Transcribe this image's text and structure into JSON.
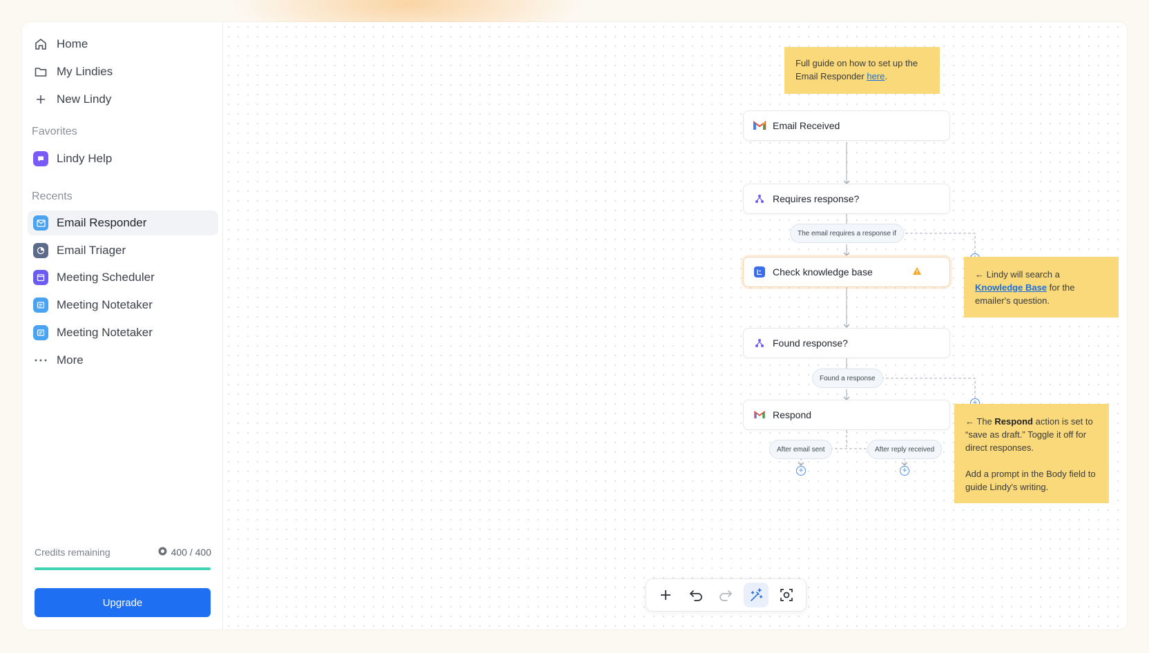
{
  "sidebar": {
    "nav": [
      {
        "label": "Home",
        "icon": "home-icon"
      },
      {
        "label": "My Lindies",
        "icon": "folder-icon"
      },
      {
        "label": "New Lindy",
        "icon": "plus-icon"
      }
    ],
    "favorites_label": "Favorites",
    "favorites": [
      {
        "label": "Lindy Help",
        "icon": "chat-bubble-icon",
        "color": "#7a5af8"
      }
    ],
    "recents_label": "Recents",
    "recents": [
      {
        "label": "Email Responder",
        "icon": "mail-icon",
        "color": "#4aa3f0",
        "active": true
      },
      {
        "label": "Email Triager",
        "icon": "pie-chart-icon",
        "color": "#5c6b8a"
      },
      {
        "label": "Meeting Scheduler",
        "icon": "calendar-icon",
        "color": "#6a5cf0"
      },
      {
        "label": "Meeting Notetaker",
        "icon": "notes-icon",
        "color": "#4aa3f0"
      },
      {
        "label": "Meeting Notetaker",
        "icon": "notes-icon",
        "color": "#4aa3f0"
      }
    ],
    "more_label": "More",
    "credits": {
      "label": "Credits remaining",
      "value": "400 / 400",
      "fraction": 1.0,
      "bar_color": "#3ed3b2"
    },
    "upgrade_label": "Upgrade"
  },
  "canvas": {
    "top_note": {
      "text_before": "Full guide on how to set up the Email Responder ",
      "link": "here",
      "text_after": "."
    },
    "nodes": {
      "email_received": "Email Received",
      "requires_response": "Requires response?",
      "check_kb": "Check knowledge base",
      "found_response": "Found response?",
      "respond": "Respond"
    },
    "pills": {
      "requires_branch": "The email requires a response if",
      "found_branch": "Found a response",
      "after_sent": "After email sent",
      "after_reply": "After reply received"
    },
    "kb_note": {
      "arrow": "←",
      "before": " Lindy will search a ",
      "link": "Knowledge Base",
      "after": " for the emailer's question."
    },
    "respond_note": {
      "arrow": "←",
      "before": " The ",
      "bold": "Respond",
      "after": " action is set to “save as draft.” Toggle it off for direct responses.",
      "second": "Add a prompt in the Body field to guide Lindy's writing."
    }
  },
  "toolbar": {
    "buttons": [
      "add-icon",
      "undo-icon",
      "redo-icon",
      "magic-wand-icon",
      "screenshot-icon"
    ],
    "active": "magic-wand-icon"
  },
  "colors": {
    "accent": "#1f6ff2",
    "note": "#f9d97a",
    "warning": "#f5a623"
  }
}
